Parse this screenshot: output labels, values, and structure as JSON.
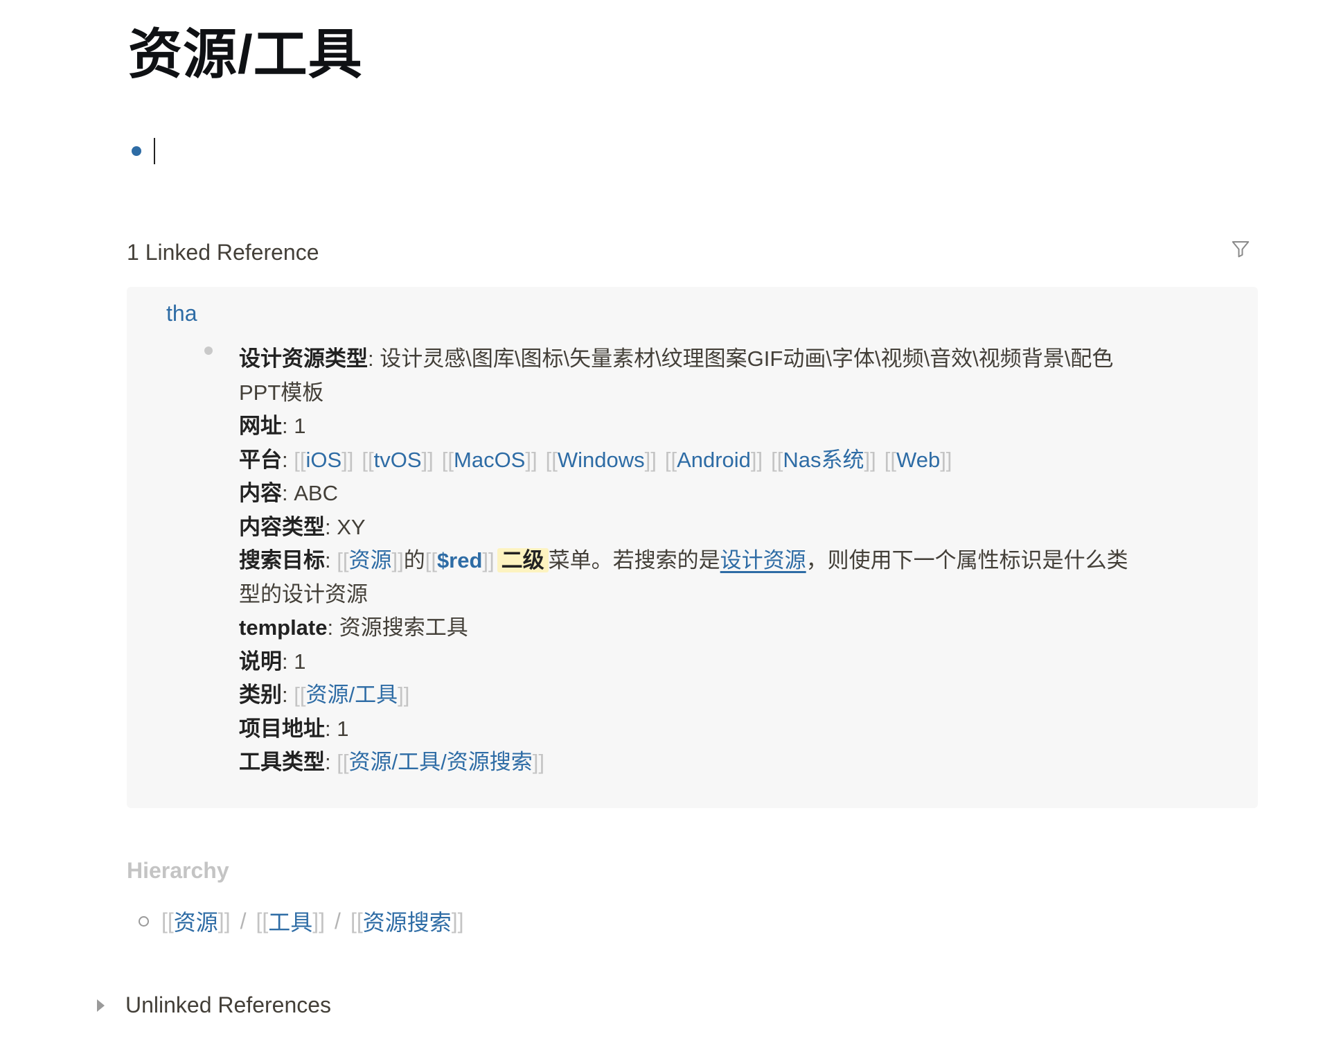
{
  "page": {
    "title": "资源/工具"
  },
  "linked_references": {
    "header": "1 Linked Reference",
    "filter_icon": "filter-icon",
    "source_page": "tha",
    "properties": {
      "design_type_key": "设计资源类型",
      "design_type_value_1": "设计灵感\\图库\\图标\\矢量素材\\纹理图案GIF动画\\字体\\视频\\音效\\视频背景\\配色",
      "design_type_value_2": "PPT模板",
      "url_key": "网址",
      "url_value": "1",
      "platform_key": "平台",
      "platforms": [
        "iOS",
        "tvOS",
        "MacOS",
        "Windows",
        "Android",
        "Nas系统",
        "Web"
      ],
      "content_key": "内容",
      "content_value": "ABC",
      "content_type_key": "内容类型",
      "content_type_value": "XY",
      "search_target_key": "搜索目标",
      "search_target_link": "资源",
      "search_target_de": "的",
      "search_target_tag": "$red",
      "search_target_highlight": "二级",
      "search_target_text_1": "菜单。若搜索的是",
      "search_target_underline": "设计资源",
      "search_target_text_2": "，则使用下一个属性标识是什么类",
      "search_target_text_3": "型的设计资源",
      "template_key": "template",
      "template_value": "资源搜索工具",
      "note_key": "说明",
      "note_value": "1",
      "category_key": "类别",
      "category_value": "资源/工具",
      "project_key": "项目地址",
      "project_value": "1",
      "tool_type_key": "工具类型",
      "tool_type_value": "资源/工具/资源搜索"
    }
  },
  "hierarchy": {
    "header": "Hierarchy",
    "items": [
      "资源",
      "工具",
      "资源搜索"
    ],
    "separator": "/"
  },
  "unlinked_references": {
    "label": "Unlinked References"
  },
  "colors": {
    "link": "#2e6ca5",
    "bracket": "#c4c4c4",
    "highlight": "#fdf3c0",
    "card_background": "#f7f7f7"
  }
}
